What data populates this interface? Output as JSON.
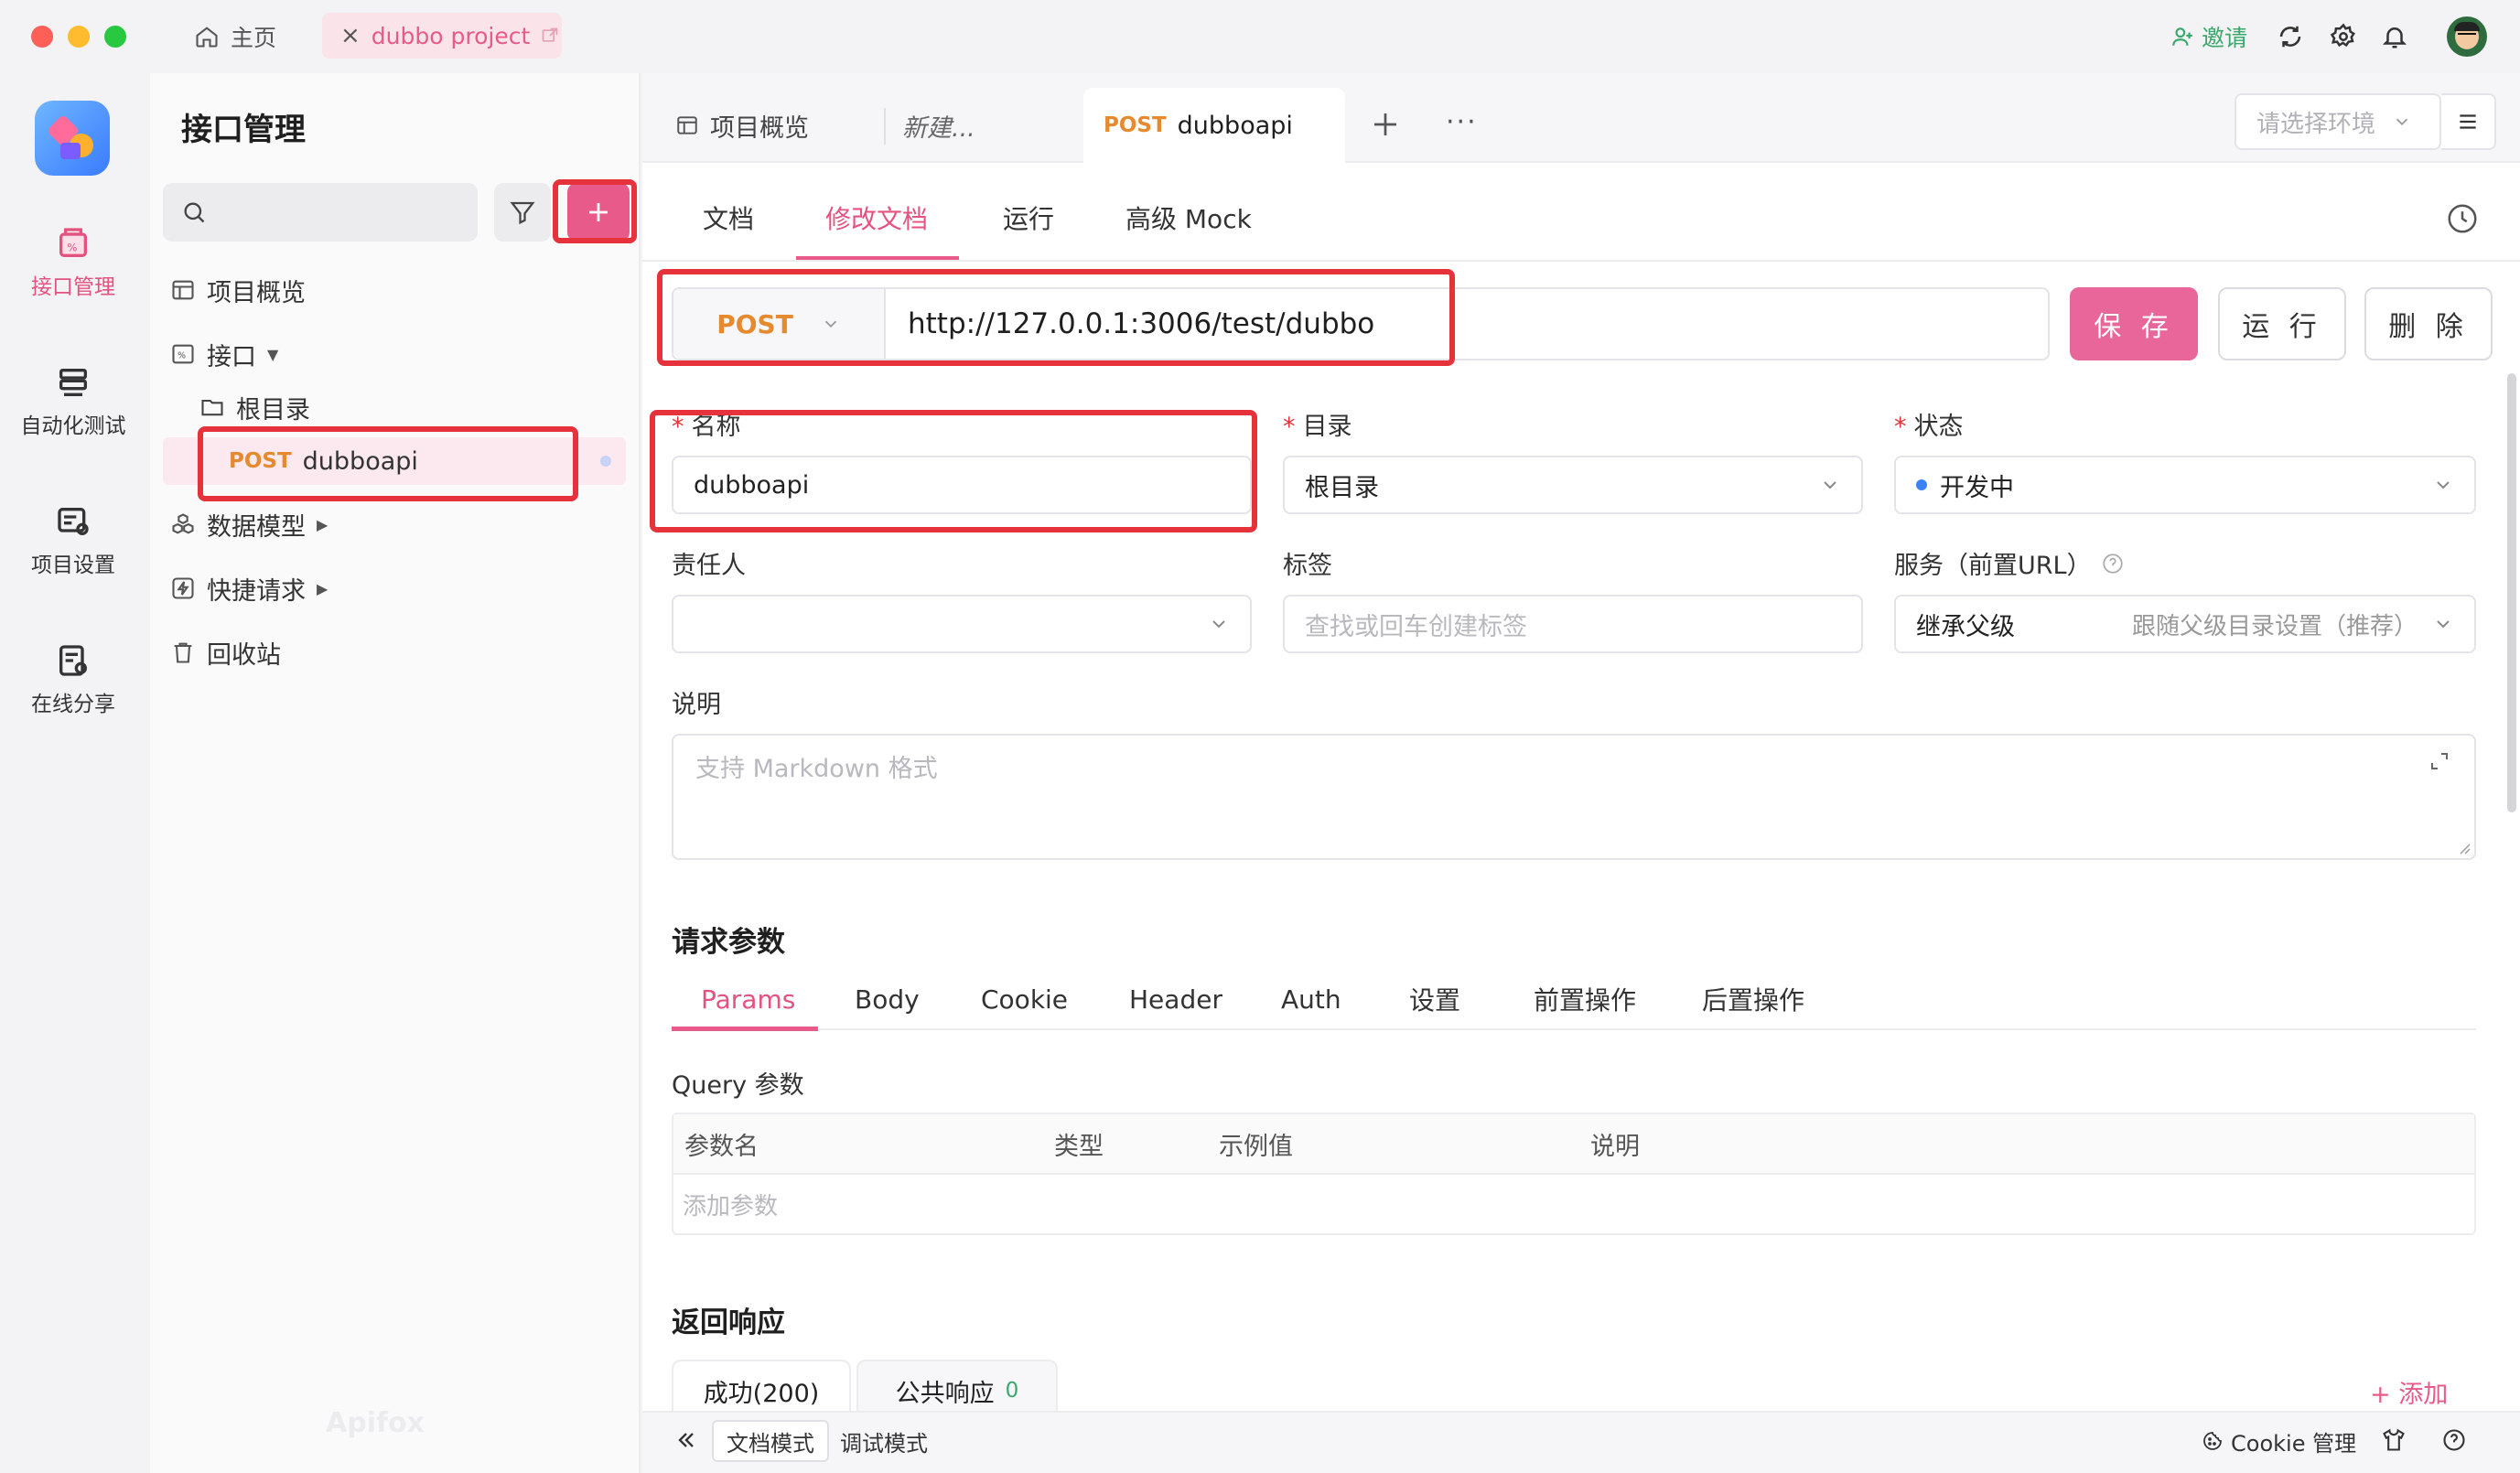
{
  "titlebar": {
    "home_label": "主页",
    "project_tab_label": "dubbo project",
    "invite_label": "邀请"
  },
  "rail": {
    "items": [
      {
        "label": "接口管理"
      },
      {
        "label": "自动化测试"
      },
      {
        "label": "项目设置"
      },
      {
        "label": "在线分享"
      }
    ]
  },
  "sidebar": {
    "title": "接口管理",
    "search_placeholder": "",
    "tree": {
      "overview": "项目概览",
      "interfaces": "接口",
      "root_folder": "根目录",
      "api_method": "POST",
      "api_name": "dubboapi",
      "data_models": "数据模型",
      "quick_requests": "快捷请求",
      "recycle_bin": "回收站"
    },
    "brand_watermark": "Apifox"
  },
  "doc_tabs": {
    "overview": "项目概览",
    "new": "新建...",
    "active_method": "POST",
    "active_name": "dubboapi",
    "env_placeholder": "请选择环境"
  },
  "sub_tabs": {
    "doc": "文档",
    "edit_doc": "修改文档",
    "run": "运行",
    "mock": "高级 Mock"
  },
  "request": {
    "method": "POST",
    "url": "http://127.0.0.1:3006/test/dubbo",
    "save": "保 存",
    "run": "运 行",
    "delete": "删 除"
  },
  "form": {
    "name_label": "名称",
    "name_value": "dubboapi",
    "folder_label": "目录",
    "folder_value": "根目录",
    "status_label": "状态",
    "status_value": "开发中",
    "owner_label": "责任人",
    "tags_label": "标签",
    "tags_placeholder": "查找或回车创建标签",
    "service_label": "服务（前置URL）",
    "service_value": "继承父级",
    "service_hint": "跟随父级目录设置（推荐）",
    "desc_label": "说明",
    "desc_placeholder": "支持 Markdown 格式"
  },
  "params": {
    "section_title": "请求参数",
    "tabs": [
      "Params",
      "Body",
      "Cookie",
      "Header",
      "Auth",
      "设置",
      "前置操作",
      "后置操作"
    ],
    "query_title": "Query 参数",
    "columns": [
      "参数名",
      "类型",
      "示例值",
      "说明"
    ],
    "add_placeholder": "添加参数"
  },
  "response": {
    "section_title": "返回响应",
    "tab_success": "成功(200)",
    "tab_common": "公共响应",
    "tab_common_count": "0",
    "add_label": "+ 添加"
  },
  "statusbar": {
    "doc_mode": "文档模式",
    "debug_mode": "调试模式",
    "cookie_manage": "Cookie 管理"
  },
  "colors": {
    "accent": "#e85a8a",
    "method_post": "#e58a2e",
    "highlight_box": "#e5323b",
    "status_dot": "#3b82f6"
  }
}
